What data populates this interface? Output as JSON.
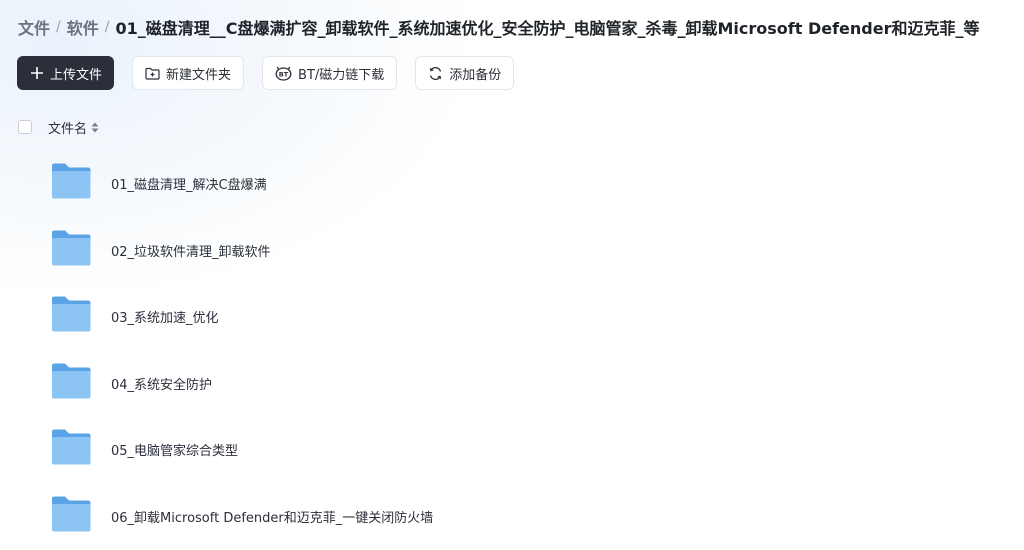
{
  "breadcrumb": {
    "items": [
      "文件",
      "软件"
    ],
    "separator": "/",
    "current": "01_磁盘清理__C盘爆满扩容_卸载软件_系统加速优化_安全防护_电脑管家_杀毒_卸载Microsoft Defender和迈克菲_等"
  },
  "toolbar": {
    "upload_label": "上传文件",
    "new_folder_label": "新建文件夹",
    "bt_label": "BT/磁力链下载",
    "backup_label": "添加备份"
  },
  "list_header": {
    "name_label": "文件名"
  },
  "files": [
    {
      "name": "01_磁盘清理_解决C盘爆满",
      "icon": "folder-icon"
    },
    {
      "name": "02_垃圾软件清理_卸载软件",
      "icon": "folder-icon"
    },
    {
      "name": "03_系统加速_优化",
      "icon": "folder-icon"
    },
    {
      "name": "04_系统安全防护",
      "icon": "folder-icon"
    },
    {
      "name": "05_电脑管家综合类型",
      "icon": "folder-icon"
    },
    {
      "name": "06_卸载Microsoft Defender和迈克菲_一键关闭防火墙",
      "icon": "folder-icon"
    }
  ],
  "colors": {
    "primary_button": "#2b2f3a",
    "folder_back": "#5aa3e6",
    "folder_front": "#8cc4f4"
  }
}
